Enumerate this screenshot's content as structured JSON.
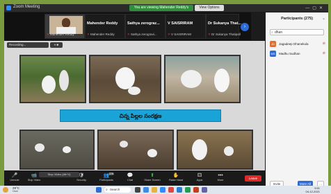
{
  "window": {
    "title": "Zoom Meeting",
    "viewing_banner": "You are viewing Mahender Reddy's screen",
    "view_options": "View Options"
  },
  "speakers": [
    {
      "name": "Mahender Reddy",
      "caption": "Mahender Reddy",
      "active": true
    },
    {
      "name": "Sathya zerograz...",
      "caption": "Sathya zerogravi...",
      "active": false
    },
    {
      "name": "V SAISRIRAM",
      "caption": "V SAISRIRAM",
      "active": false
    },
    {
      "name": "Dr Sukanya That...",
      "caption": "Dr Sukanya Thatipall",
      "active": false
    }
  ],
  "share": {
    "tab_label": "Recording...",
    "tab2_label": "",
    "slide_banner": "చిన్న పిల్లల సంరక్షణ"
  },
  "participants": {
    "title": "Participants (275)",
    "search_value": "dhan",
    "items": [
      {
        "initials": "JD",
        "name": "Jagadeep Dhanekula",
        "color": "#e2702d"
      },
      {
        "initials": "MS",
        "name": "Madhu Sudhan",
        "color": "#2d6bd8"
      }
    ],
    "invite_label": "Invite",
    "mute_all_label": "Mute All",
    "more_label": "..."
  },
  "toolbar": {
    "stop_video_tip": "Stop Video (Alt+V)",
    "items": [
      {
        "label": "Unmute",
        "icon": "🎤"
      },
      {
        "label": "Stop Video",
        "icon": "📹"
      },
      {
        "label": "Security",
        "icon": "🛡"
      },
      {
        "label": "Participants",
        "icon": "👥",
        "badge": "275"
      },
      {
        "label": "Chat",
        "icon": "💬"
      },
      {
        "label": "Share Screen",
        "icon": "⬆"
      },
      {
        "label": "Raise Hand",
        "icon": "✋"
      },
      {
        "label": "Apps",
        "icon": "⚃"
      },
      {
        "label": "More",
        "icon": "•••"
      }
    ],
    "leave_label": "Leave"
  },
  "taskbar": {
    "weather_temp": "29°C",
    "weather_desc": "Haze",
    "search_label": "Search",
    "clock_time": "9:51",
    "clock_date": "04-12-2021"
  }
}
